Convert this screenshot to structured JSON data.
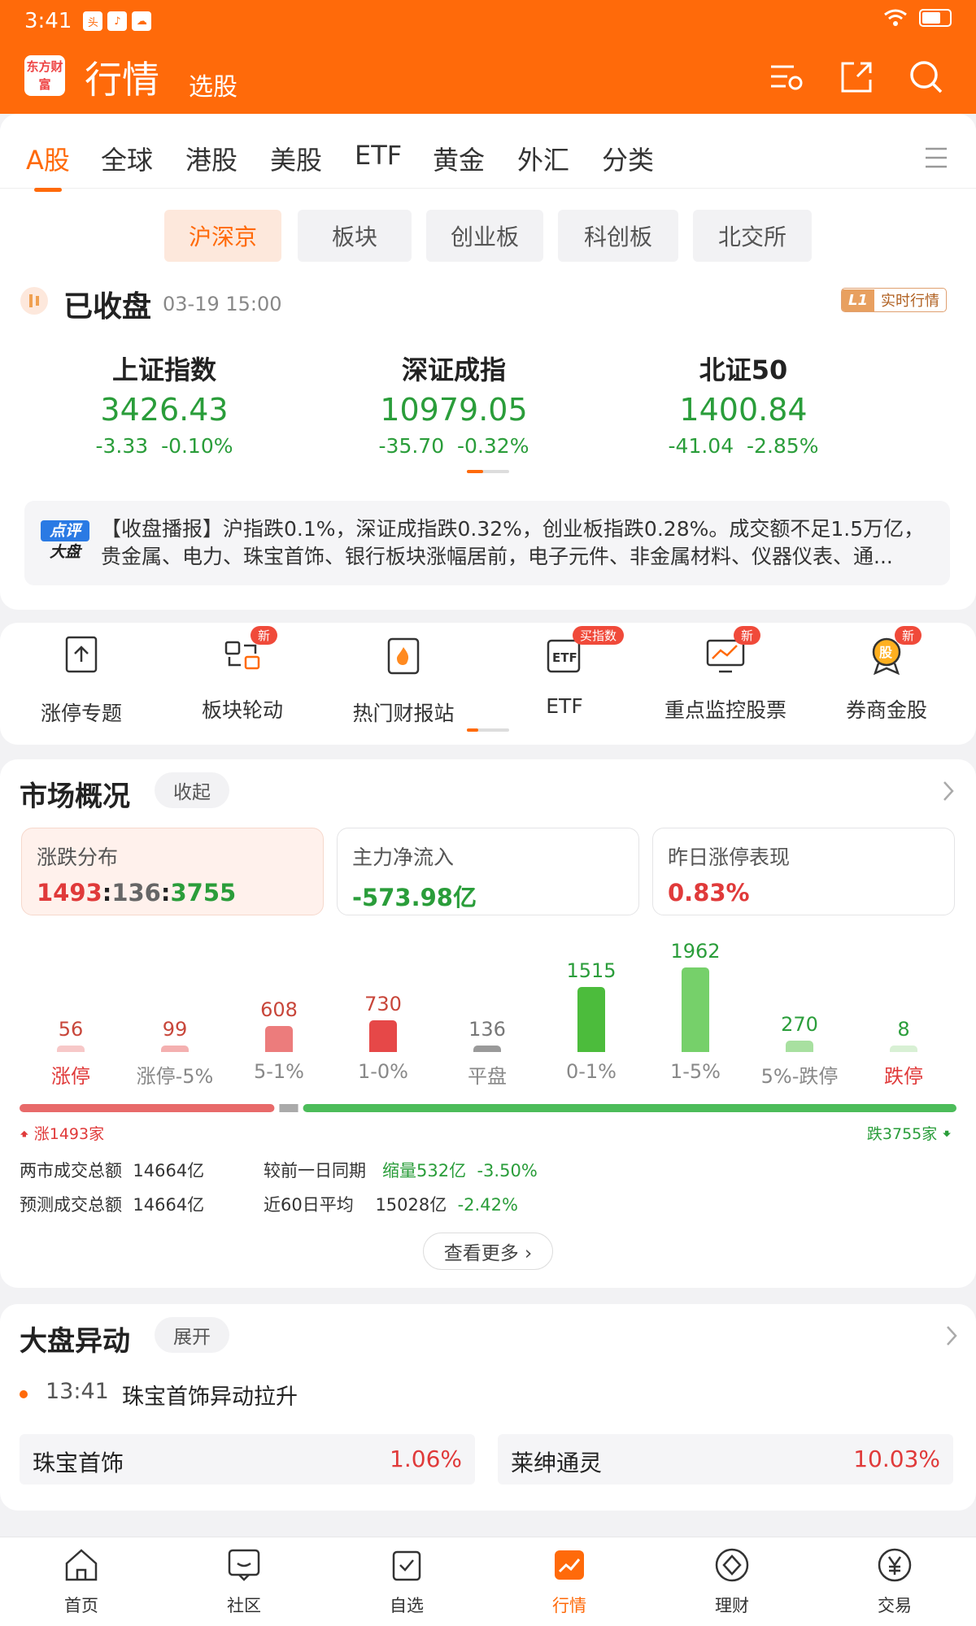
{
  "status": {
    "time": "3:41"
  },
  "header": {
    "logo": "东方财富",
    "title": "行情",
    "sub": "选股"
  },
  "tabs": [
    "A股",
    "全球",
    "港股",
    "美股",
    "ETF",
    "黄金",
    "外汇",
    "分类"
  ],
  "subtabs": [
    "沪深京",
    "板块",
    "创业板",
    "科创板",
    "北交所"
  ],
  "market": {
    "status": "已收盘",
    "time": "03-19 15:00",
    "badge_l1": "L1",
    "badge": "实时行情"
  },
  "indices": [
    {
      "name": "上证指数",
      "value": "3426.43",
      "change": "-3.33",
      "pct": "-0.10%"
    },
    {
      "name": "深证成指",
      "value": "10979.05",
      "change": "-35.70",
      "pct": "-0.32%"
    },
    {
      "name": "北证50",
      "value": "1400.84",
      "change": "-41.04",
      "pct": "-2.85%"
    }
  ],
  "news": {
    "tag1": "点评",
    "tag2": "大盘",
    "text": "【收盘播报】沪指跌0.1%，深证成指跌0.32%，创业板指跌0.28%。成交额不足1.5万亿，贵金属、电力、珠宝首饰、银行板块涨幅居前，电子元件、非金属材料、仪器仪表、通..."
  },
  "quick": [
    {
      "label": "涨停专题",
      "badge": ""
    },
    {
      "label": "板块轮动",
      "badge": "新"
    },
    {
      "label": "热门财报站",
      "badge": ""
    },
    {
      "label": "ETF",
      "badge": "买指数"
    },
    {
      "label": "重点监控股票",
      "badge": "新"
    },
    {
      "label": "券商金股",
      "badge": "新"
    }
  ],
  "overview": {
    "title": "市场概况",
    "toggle": "收起",
    "cards": [
      {
        "label": "涨跌分布",
        "up": "1493",
        "flat": "136",
        "down": "3755"
      },
      {
        "label": "主力净流入",
        "value": "-573.98亿"
      },
      {
        "label": "昨日涨停表现",
        "value": "0.83%"
      }
    ]
  },
  "chart_data": {
    "type": "bar",
    "categories": [
      "涨停",
      "涨停-5%",
      "5-1%",
      "1-0%",
      "平盘",
      "0-1%",
      "1-5%",
      "5%-跌停",
      "跌停"
    ],
    "values": [
      56,
      99,
      608,
      730,
      136,
      1515,
      1962,
      270,
      8
    ]
  },
  "breadth": {
    "up": "涨1493家",
    "down": "跌3755家",
    "up_count": 1493,
    "flat_count": 136,
    "down_count": 3755
  },
  "stats": {
    "total_label": "两市成交总额",
    "total": "14664亿",
    "pred_label": "预测成交总额",
    "pred": "14664亿",
    "prev_label": "较前一日同期",
    "prev": "缩量532亿",
    "prev_pct": "-3.50%",
    "avg_label": "近60日平均",
    "avg": "15028亿",
    "avg_pct": "-2.42%",
    "more": "查看更多 ›"
  },
  "movement": {
    "title": "大盘异动",
    "toggle": "展开",
    "time": "13:41",
    "event": "珠宝首饰异动拉升",
    "items": [
      {
        "name": "珠宝首饰",
        "pct": "1.06%"
      },
      {
        "name": "莱绅通灵",
        "pct": "10.03%"
      }
    ]
  },
  "nav": [
    "首页",
    "社区",
    "自选",
    "行情",
    "理财",
    "交易"
  ],
  "colors": {
    "brand": "#ff6a0a",
    "up": "#e03a3a",
    "down": "#2a9d3a"
  }
}
